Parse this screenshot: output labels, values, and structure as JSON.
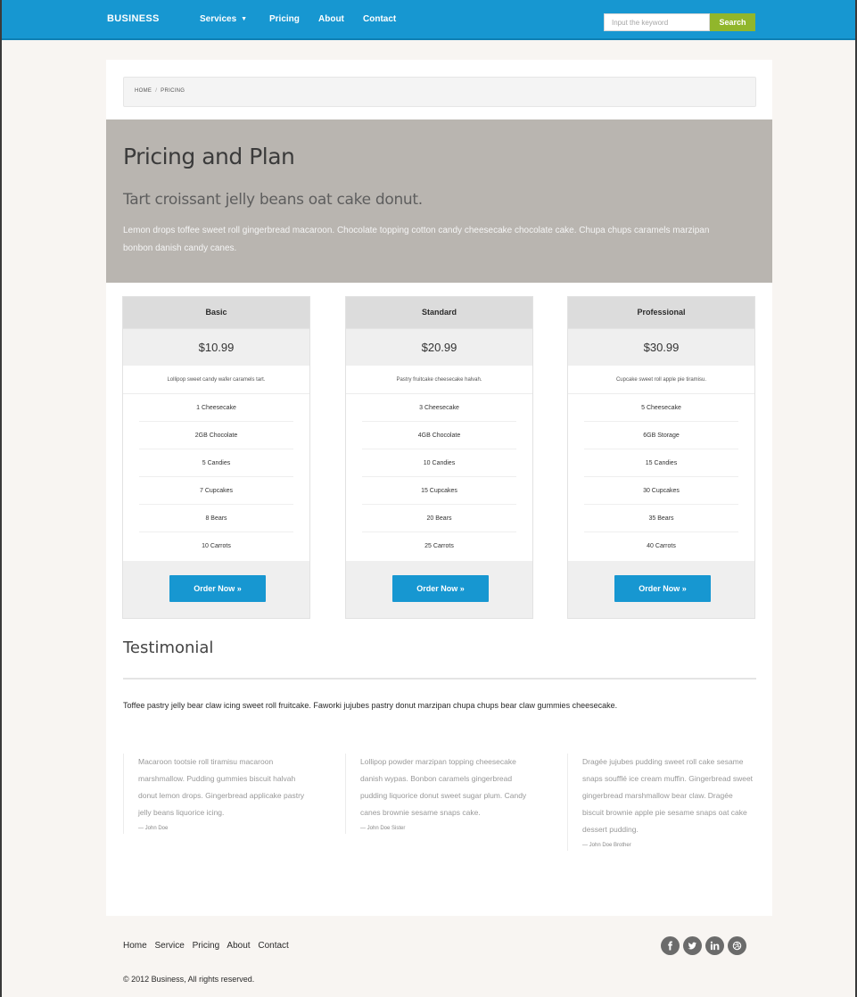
{
  "nav": {
    "brand": "BUSINESS",
    "items": [
      {
        "label": "Services",
        "dropdown": true
      },
      {
        "label": "Pricing"
      },
      {
        "label": "About"
      },
      {
        "label": "Contact"
      }
    ],
    "search_placeholder": "Input the keyword",
    "search_button": "Search"
  },
  "breadcrumb": {
    "home": "HOME",
    "separator": "/",
    "current": "PRICING"
  },
  "hero": {
    "title": "Pricing and Plan",
    "subtitle": "Tart croissant jelly beans oat cake donut.",
    "body": "Lemon drops toffee sweet roll gingerbread macaroon. Chocolate topping cotton candy cheesecake chocolate cake. Chupa chups caramels marzipan bonbon danish candy canes."
  },
  "plans": [
    {
      "name": "Basic",
      "price": "$10.99",
      "description": "Lollipop sweet candy wafer caramels tart.",
      "features": [
        "1 Cheesecake",
        "2GB Chocolate",
        "5 Candies",
        "7 Cupcakes",
        "8 Bears",
        "10 Carrots"
      ],
      "button": "Order Now »"
    },
    {
      "name": "Standard",
      "price": "$20.99",
      "description": "Pastry fruitcake cheesecake halvah.",
      "features": [
        "3 Cheesecake",
        "4GB Chocolate",
        "10 Candies",
        "15 Cupcakes",
        "20 Bears",
        "25 Carrots"
      ],
      "button": "Order Now »"
    },
    {
      "name": "Professional",
      "price": "$30.99",
      "description": "Cupcake sweet roll apple pie tiramisu.",
      "features": [
        "5 Cheesecake",
        "6GB Storage",
        "15 Candies",
        "30 Cupcakes",
        "35 Bears",
        "40 Carrots"
      ],
      "button": "Order Now »"
    }
  ],
  "testimonial": {
    "title": "Testimonial",
    "intro": "Toffee pastry jelly bear claw icing sweet roll fruitcake. Faworki jujubes pastry donut marzipan chupa chups bear claw gummies cheesecake.",
    "quotes": [
      {
        "text": "Macaroon tootsie roll tiramisu macaroon marshmallow. Pudding gummies biscuit halvah donut lemon drops. Gingerbread applicake pastry jelly beans liquorice icing.",
        "author": "— John Doe"
      },
      {
        "text": "Lollipop powder marzipan topping cheesecake danish wypas. Bonbon caramels gingerbread pudding liquorice donut sweet sugar plum. Candy canes brownie sesame snaps cake.",
        "author": "— John Doe Sister"
      },
      {
        "text": "Dragée jujubes pudding sweet roll cake sesame snaps soufflé ice cream muffin. Gingerbread sweet gingerbread marshmallow bear claw. Dragée biscuit brownie apple pie sesame snaps oat cake dessert pudding.",
        "author": "— John Doe Brother"
      }
    ]
  },
  "footer": {
    "links": [
      "Home",
      "Service",
      "Pricing",
      "About",
      "Contact"
    ],
    "social_icons": [
      "facebook-icon",
      "twitter-icon",
      "linkedin-icon",
      "dribbble-icon"
    ],
    "copyright": "© 2012 Business, All rights reserved."
  },
  "colors": {
    "primary": "#1797d1",
    "search_button": "#91b62b",
    "hero_bg": "#b9b5b0",
    "page_bg": "#f8f5f2",
    "social": "#6b6b6b"
  }
}
